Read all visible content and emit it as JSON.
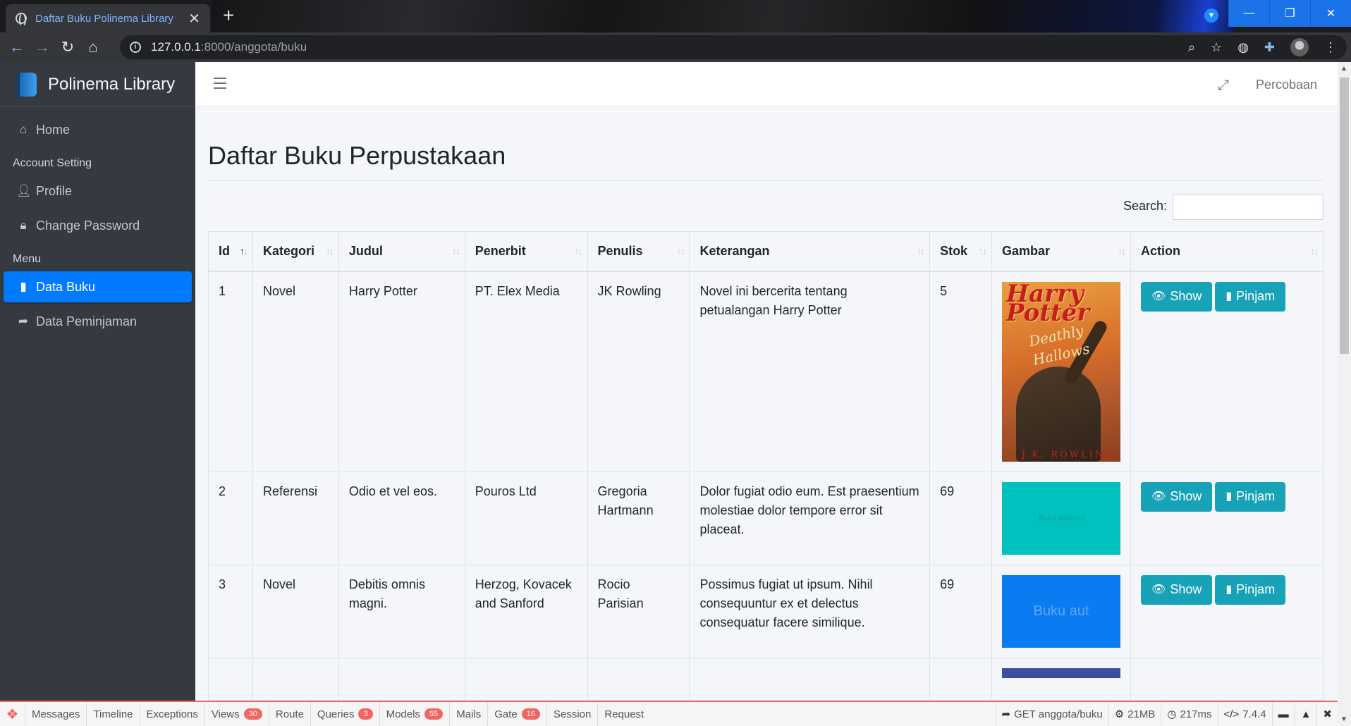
{
  "browser": {
    "tab_title": "Daftar Buku Polinema Library",
    "tab_close": "✕",
    "new_tab": "+",
    "url_host": "127.0.0.1",
    "url_path": ":8000/anggota/buku",
    "win_minimize": "—",
    "win_restore": "❐",
    "win_close": "✕"
  },
  "sidebar": {
    "brand": "Polinema Library",
    "items": [
      {
        "label": "Home",
        "icon": "home-icon"
      },
      {
        "label": "Profile",
        "icon": "user-icon"
      },
      {
        "label": "Change Password",
        "icon": "lock-icon"
      },
      {
        "label": "Data Buku",
        "icon": "book-icon",
        "active": true
      },
      {
        "label": "Data Peminjaman",
        "icon": "share-icon"
      }
    ],
    "headers": [
      "Account Setting",
      "Menu"
    ]
  },
  "header": {
    "user_name": "Percobaan"
  },
  "main": {
    "title": "Daftar Buku Perpustakaan",
    "search_label": "Search:",
    "search_value": "",
    "columns": [
      "Id",
      "Kategori",
      "Judul",
      "Penerbit",
      "Penulis",
      "Keterangan",
      "Stok",
      "Gambar",
      "Action"
    ],
    "rows": [
      {
        "id": "1",
        "kategori": "Novel",
        "judul": "Harry Potter",
        "penerbit": "PT. Elex Media",
        "penulis": "JK Rowling",
        "keterangan": "Novel ini bercerita tentang petualangan Harry Potter",
        "stok": "5",
        "cover_title": "Harry Potter",
        "cover_subtitle": "Deathly Hallows",
        "cover_author": "J.K. ROWLING"
      },
      {
        "id": "2",
        "kategori": "Referensi",
        "judul": "Odio et vel eos.",
        "penerbit": "Pouros Ltd",
        "penulis": "Gregoria Hartmann",
        "keterangan": "Dolor fugiat odio eum. Est praesentium molestiae dolor tempore error sit placeat.",
        "stok": "69",
        "cover_text": "Buku adipisci",
        "cover_color": "#00c1be"
      },
      {
        "id": "3",
        "kategori": "Novel",
        "judul": "Debitis omnis magni.",
        "penerbit": "Herzog, Kovacek and Sanford",
        "penulis": "Rocio Parisian",
        "keterangan": "Possimus fugiat ut ipsum. Nihil consequuntur ex et delectus consequatur facere similique.",
        "stok": "69",
        "cover_text": "Buku aut",
        "cover_color": "#0a7bf0"
      }
    ],
    "show_label": "Show",
    "pinjam_label": "Pinjam"
  },
  "debugbar": {
    "tabs": [
      {
        "label": "Messages"
      },
      {
        "label": "Timeline"
      },
      {
        "label": "Exceptions"
      },
      {
        "label": "Views",
        "badge": "30"
      },
      {
        "label": "Route"
      },
      {
        "label": "Queries",
        "badge": "3"
      },
      {
        "label": "Models",
        "badge": "55"
      },
      {
        "label": "Mails"
      },
      {
        "label": "Gate",
        "badge": "16"
      },
      {
        "label": "Session"
      },
      {
        "label": "Request"
      }
    ],
    "route": "GET anggota/buku",
    "memory": "21MB",
    "time": "217ms",
    "php_version": "7.4.4",
    "accent": "#f4645f"
  }
}
